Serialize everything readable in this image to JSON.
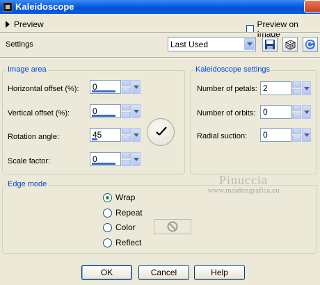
{
  "window": {
    "title": "Kaleidoscope"
  },
  "preview": {
    "label": "Preview",
    "preview_on_image_label": "Preview on Image",
    "preview_on_image_checked": false
  },
  "settings": {
    "label": "Settings",
    "selected": "Last Used"
  },
  "image_area": {
    "title": "Image area",
    "horizontal_offset": {
      "label": "Horizontal offset (%):",
      "value": "0",
      "level": 0.5
    },
    "vertical_offset": {
      "label": "Vertical offset (%):",
      "value": "0",
      "level": 0.5
    },
    "rotation_angle": {
      "label": "Rotation angle:",
      "value": "45",
      "level": 0.12
    },
    "scale_factor": {
      "label": "Scale factor:",
      "value": "0",
      "level": 0.5
    }
  },
  "kaleidoscope_settings": {
    "title": "Kaleidoscope settings",
    "number_of_petals": {
      "label": "Number of petals:",
      "value": "2"
    },
    "number_of_orbits": {
      "label": "Number of orbits:",
      "value": "0"
    },
    "radial_suction": {
      "label": "Radial suction:",
      "value": "0"
    }
  },
  "edge_mode": {
    "title": "Edge mode",
    "options": [
      "Wrap",
      "Repeat",
      "Color",
      "Reflect"
    ],
    "selected": "Wrap"
  },
  "watermark": {
    "line1": "Pinuccia",
    "line2": "www.maidiregrafica.eu"
  },
  "buttons": {
    "ok": "OK",
    "cancel": "Cancel",
    "help": "Help"
  },
  "colors": {
    "title_bar": "#0a5ce0",
    "group_title": "#0046d5",
    "dialog_bg": "#ece9d8"
  },
  "icons": [
    "kaleidoscope-app-icon",
    "close-icon",
    "save-preset-icon",
    "randomize-dice-icon",
    "reset-icon",
    "angle-dial-icon",
    "no-color-icon"
  ]
}
